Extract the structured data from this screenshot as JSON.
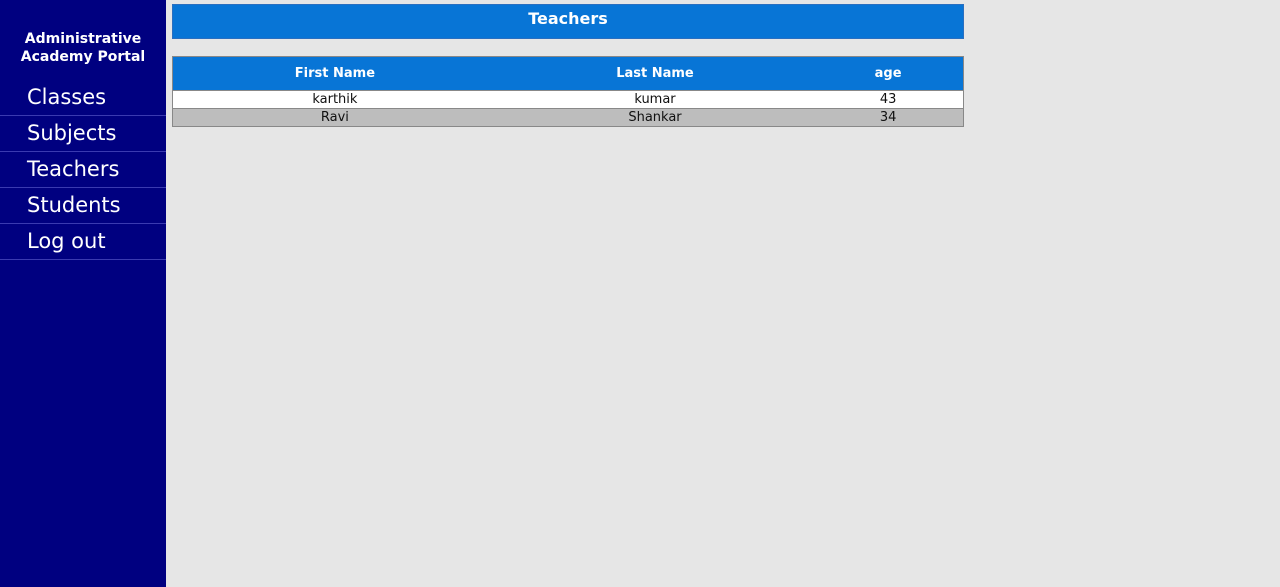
{
  "sidebar": {
    "brand_line1": "Administrative",
    "brand_line2": "Academy Portal",
    "items": [
      {
        "label": "Classes"
      },
      {
        "label": "Subjects"
      },
      {
        "label": "Teachers"
      },
      {
        "label": "Students"
      },
      {
        "label": "Log out"
      }
    ]
  },
  "main": {
    "title": "Teachers",
    "table": {
      "headers": [
        "First Name",
        "Last Name",
        "age"
      ],
      "rows": [
        [
          "karthik",
          "kumar",
          "43"
        ],
        [
          "Ravi",
          "Shankar",
          "34"
        ]
      ]
    }
  },
  "colors": {
    "sidebar_bg": "#000080",
    "header_blue": "#0875d6",
    "page_bg": "#e6e6e6",
    "alt_row": "#bdbdbd"
  }
}
